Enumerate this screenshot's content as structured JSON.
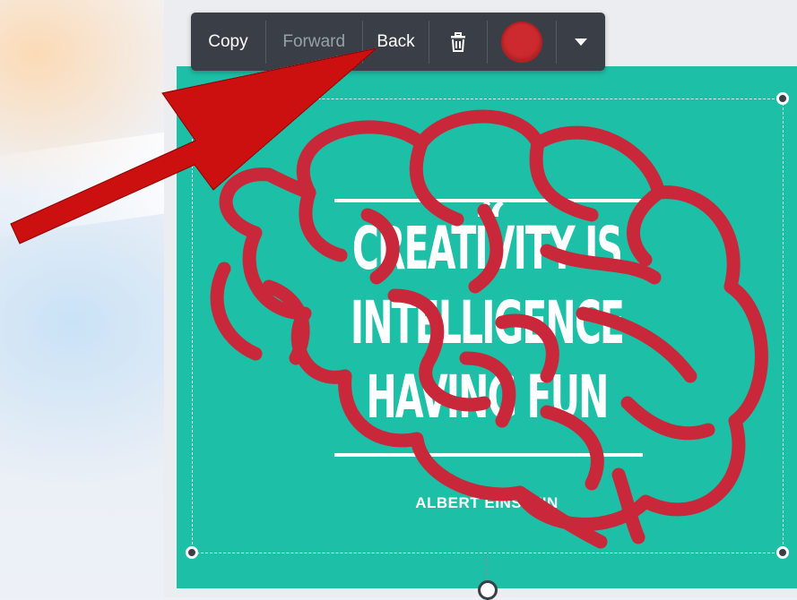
{
  "toolbar": {
    "copy_label": "Copy",
    "forward_label": "Forward",
    "back_label": "Back",
    "delete_icon": "trash-icon",
    "color_swatch_icon": "color-swatch-icon",
    "more_icon": "chevron-down-icon",
    "selected_color": "#cc2a2e"
  },
  "design": {
    "quote_mark": "“",
    "lines": [
      "CREATIVITY IS",
      "INTELLIGENCE",
      "HAVING FUN"
    ],
    "author": "ALBERT EINSTEIN",
    "background_color": "#1dbfa6",
    "overlay_icon": "brain-outline-icon",
    "overlay_color": "#c8283a"
  },
  "annotation": {
    "arrow_icon": "red-arrow-icon",
    "arrow_color": "#cc1010"
  }
}
